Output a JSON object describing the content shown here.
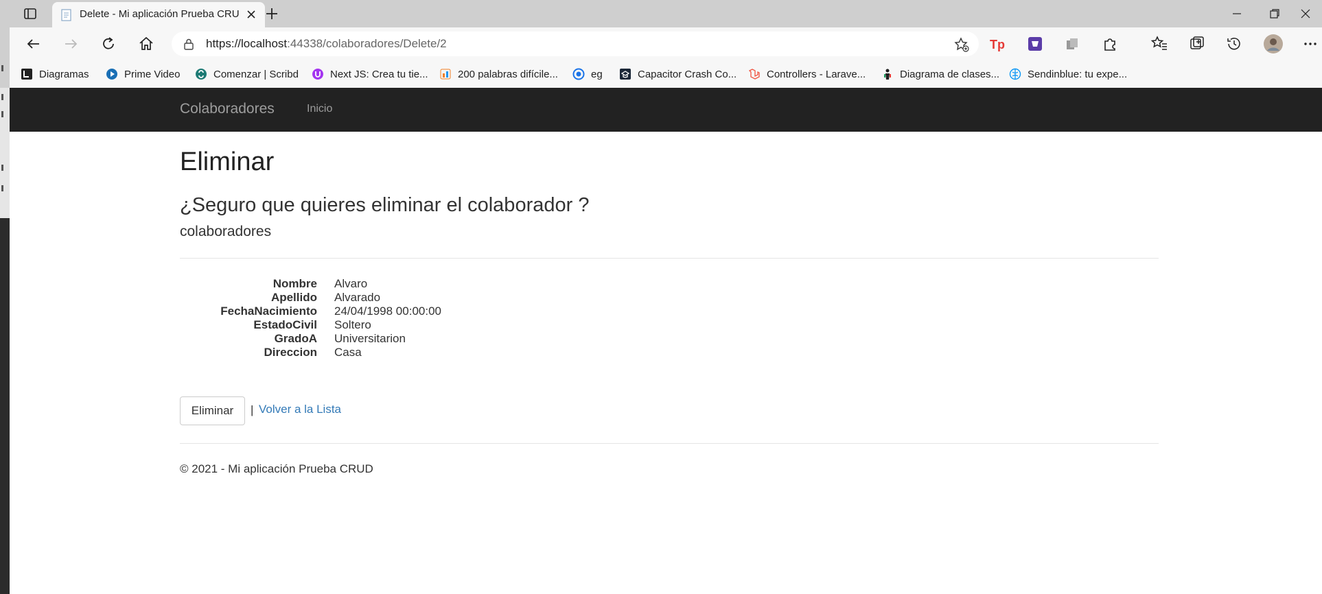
{
  "browser": {
    "tab": {
      "title": "Delete - Mi aplicación Prueba CRUD"
    },
    "url": {
      "host": "https://localhost",
      "path": ":44338/colaboradores/Delete/2"
    },
    "bookmarks": [
      {
        "label": "Diagramas",
        "icon": "diagramas-icon"
      },
      {
        "label": "Prime Video",
        "icon": "prime-video-icon"
      },
      {
        "label": "Comenzar | Scribd",
        "icon": "scribd-icon"
      },
      {
        "label": "Next JS: Crea tu tie...",
        "icon": "nextjs-icon"
      },
      {
        "label": "200 palabras difícile...",
        "icon": "palabras-icon"
      },
      {
        "label": "eg",
        "icon": "eg-icon"
      },
      {
        "label": "Capacitor Crash Co...",
        "icon": "capacitor-icon"
      },
      {
        "label": "Controllers - Larave...",
        "icon": "laravel-icon"
      },
      {
        "label": "Diagrama de clases...",
        "icon": "diagrama-clases-icon"
      },
      {
        "label": "Sendinblue: tu expe...",
        "icon": "sendinblue-icon"
      }
    ],
    "colors": {
      "tabbar": "#cfcfcf",
      "toolbar": "#f7f7f7"
    }
  },
  "site": {
    "brand": "Colaboradores",
    "nav": {
      "home": "Inicio"
    },
    "colors": {
      "navbar": "#222222",
      "link": "#337ab7"
    }
  },
  "page": {
    "title": "Eliminar",
    "question": "¿Seguro que quieres eliminar el colaborador ?",
    "subtitle": "colaboradores",
    "fields": [
      {
        "label": "Nombre",
        "value": "Alvaro"
      },
      {
        "label": "Apellido",
        "value": "Alvarado"
      },
      {
        "label": "FechaNacimiento",
        "value": "24/04/1998 00:00:00"
      },
      {
        "label": "EstadoCivil",
        "value": "Soltero"
      },
      {
        "label": "GradoA",
        "value": "Universitarion"
      },
      {
        "label": "Direccion",
        "value": "Casa"
      }
    ],
    "delete_button": "Eliminar",
    "separator": "|",
    "back_link": "Volver a la Lista",
    "footer": "© 2021 - Mi aplicación Prueba CRUD"
  }
}
